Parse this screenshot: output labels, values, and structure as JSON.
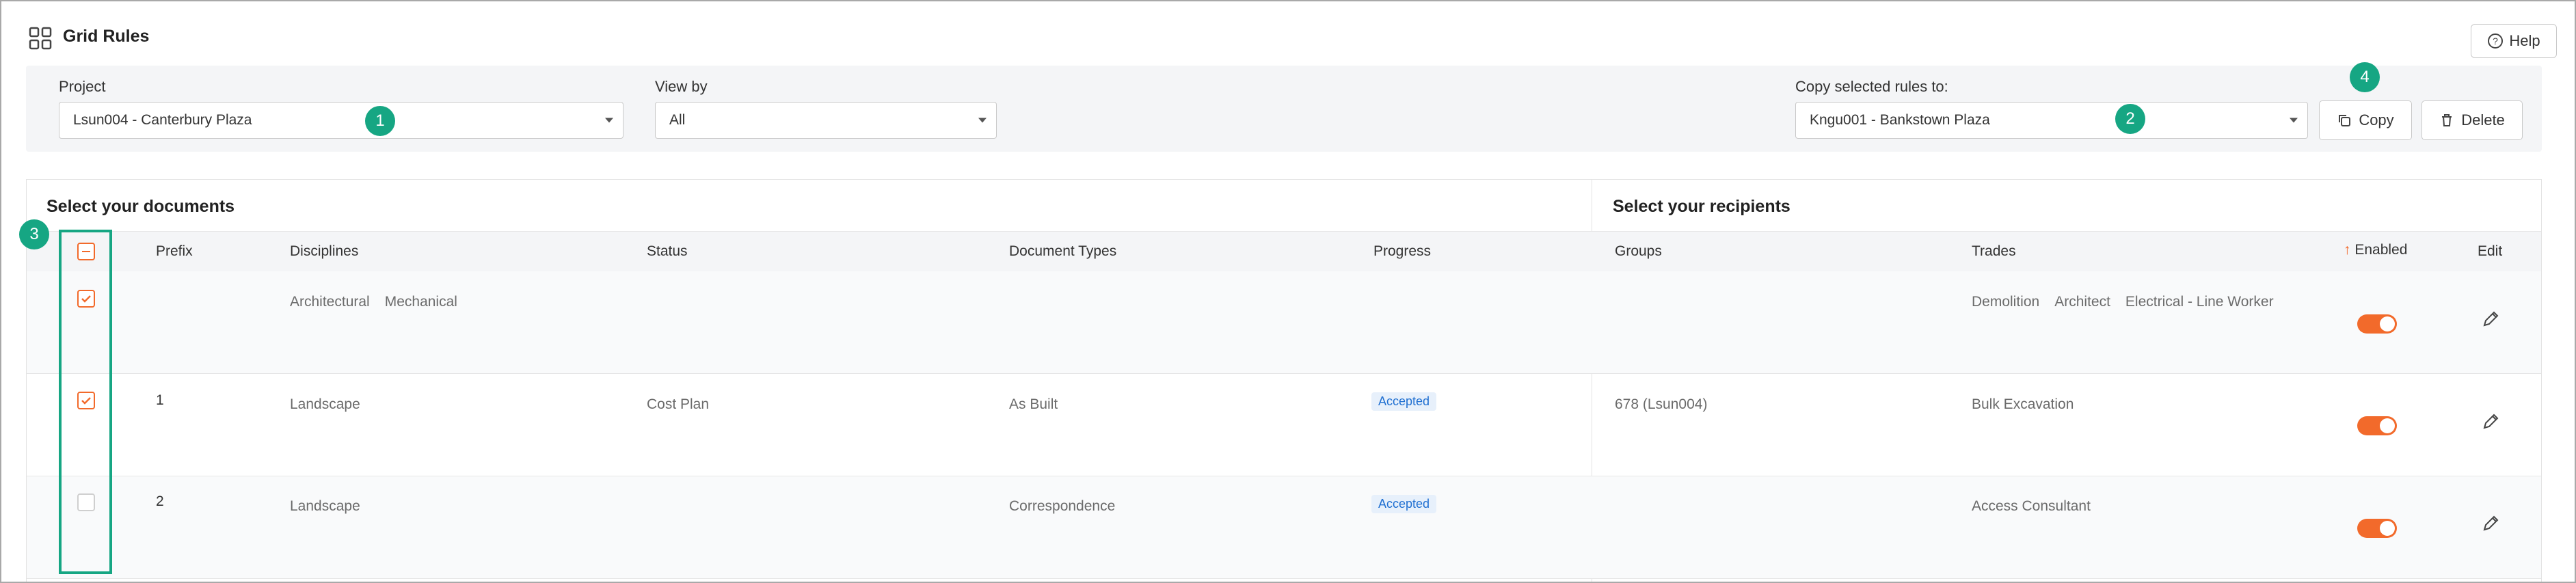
{
  "header": {
    "title": "Grid Rules",
    "help_label": "Help"
  },
  "filters": {
    "project_label": "Project",
    "project_value": "Lsun004 - Canterbury Plaza",
    "viewby_label": "View by",
    "viewby_value": "All",
    "copy_to_label": "Copy selected rules to:",
    "copy_to_value": "Kngu001 - Bankstown Plaza",
    "copy_label": "Copy",
    "delete_label": "Delete"
  },
  "markers": [
    "1",
    "2",
    "3",
    "4"
  ],
  "documents": {
    "title": "Select your documents",
    "columns": {
      "prefix": "Prefix",
      "disciplines": "Disciplines",
      "status": "Status",
      "doc_types": "Document Types",
      "progress": "Progress"
    }
  },
  "recipients": {
    "title": "Select your recipients",
    "columns": {
      "groups": "Groups",
      "trades": "Trades",
      "enabled": "Enabled",
      "edit": "Edit"
    },
    "sort_glyph": "↑"
  },
  "rows": [
    {
      "checked": true,
      "prefix": "",
      "disciplines": [
        "Architectural",
        "Mechanical"
      ],
      "status": "",
      "doc_type": "",
      "progress": "",
      "groups": "",
      "trades": [
        "Demolition",
        "Architect",
        "Electrical - Line Worker"
      ],
      "enabled": true
    },
    {
      "checked": true,
      "prefix": "1",
      "disciplines": [
        "Landscape"
      ],
      "status": "Cost Plan",
      "doc_type": "As Built",
      "progress": "Accepted",
      "groups": "678 (Lsun004)",
      "trades": [
        "Bulk Excavation"
      ],
      "enabled": true
    },
    {
      "checked": false,
      "prefix": "2",
      "disciplines": [
        "Landscape"
      ],
      "status": "",
      "doc_type": "Correspondence",
      "progress": "Accepted",
      "groups": "",
      "trades": [
        "Access Consultant"
      ],
      "enabled": true
    }
  ],
  "colors": {
    "accent": "#f26a2b",
    "marker": "#16a683",
    "badge_text": "#1f6fd1",
    "badge_bg": "#e7f0fb",
    "panel_bg": "#f4f5f7"
  }
}
